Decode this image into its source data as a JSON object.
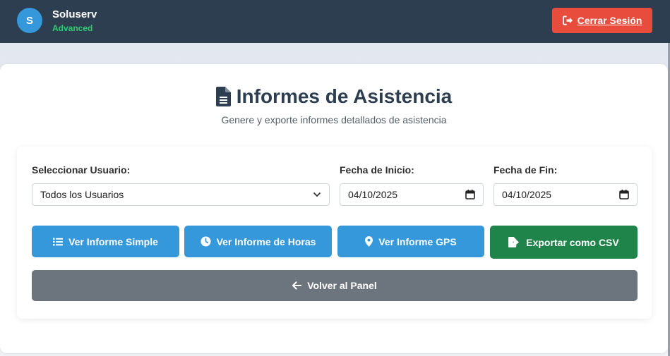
{
  "header": {
    "avatar_letter": "S",
    "app_name": "Soluserv",
    "plan": "Advanced",
    "logout_label": "Cerrar Sesión"
  },
  "main": {
    "title": "Informes de Asistencia",
    "subtitle": "Genere y exporte informes detallados de asistencia",
    "title_icon": "file-document-icon"
  },
  "filters": {
    "user_label": "Seleccionar Usuario:",
    "user_value": "Todos los Usuarios",
    "start_label": "Fecha de Inicio:",
    "start_value": "04/10/2025",
    "end_label": "Fecha de Fin:",
    "end_value": "04/10/2025"
  },
  "actions": {
    "simple_label": "Ver Informe Simple",
    "hours_label": "Ver Informe de Horas",
    "gps_label": "Ver Informe GPS",
    "csv_label": "Exportar como CSV",
    "back_label": "Volver al Panel"
  },
  "colors": {
    "header_bg": "#2c3e50",
    "accent_blue": "#3498db",
    "danger": "#e74c3c",
    "success": "#1e8449",
    "secondary": "#6c757d",
    "plan_green": "#2ecc71"
  }
}
